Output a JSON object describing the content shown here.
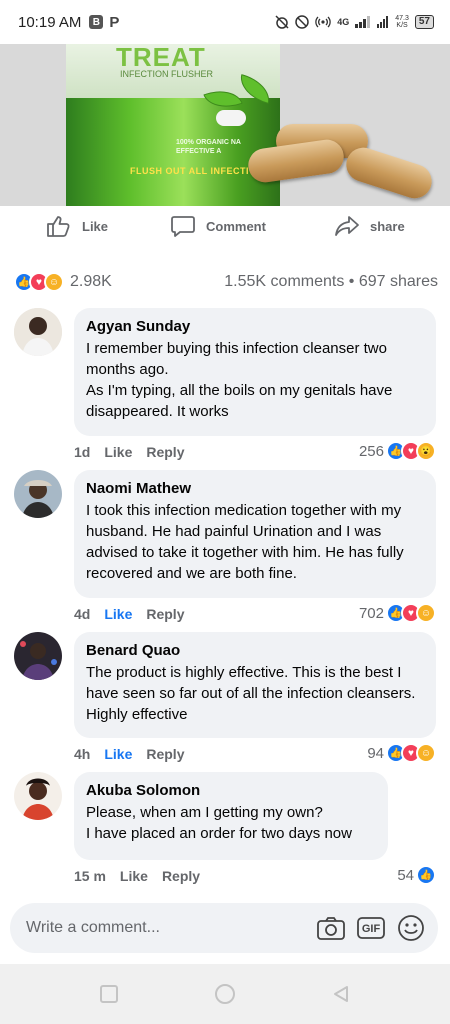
{
  "status_bar": {
    "time": "10:19 AM",
    "app_icon": "B",
    "app_icon2": "P",
    "network": "4G",
    "speed_value": "47.3",
    "speed_unit": "K/S",
    "battery": "57"
  },
  "product": {
    "brand": "TREAT",
    "subtitle": "INFECTION FLUSHER",
    "organic_line1": "100% ORGANIC NA",
    "organic_line2": "EFFECTIVE A",
    "flush_text": "FLUSH OUT ALL INFECTI"
  },
  "actions": {
    "like": "Like",
    "comment": "Comment",
    "share": "share"
  },
  "summary": {
    "reaction_count": "2.98K",
    "comments_shares": "1.55K comments • 697 shares"
  },
  "comments": [
    {
      "name": "Agyan Sunday",
      "text": "I remember buying this infection cleanser two months ago.\nAs I'm typing, all the boils on my genitals have disappeared. It works",
      "time": "1d",
      "like": "Like",
      "reply": "Reply",
      "count": "256",
      "liked": false
    },
    {
      "name": "Naomi Mathew",
      "text": "I took this infection medication together with my husband. He had painful Urination and I was advised to take it together with him. He has fully recovered and we are both fine.",
      "time": "4d",
      "like": "Like",
      "reply": "Reply",
      "count": "702",
      "liked": true
    },
    {
      "name": "Benard Quao",
      "text": "The product is highly effective. This is the best I have seen so far out of all the infection cleansers. Highly effective",
      "time": "4h",
      "like": "Like",
      "reply": "Reply",
      "count": "94",
      "liked": true
    },
    {
      "name": "Akuba Solomon",
      "text": "Please, when am I getting my own?\nI have placed an order for two days now",
      "time": "15 m",
      "like": "Like",
      "reply": "Reply",
      "count": "54",
      "liked": false
    }
  ],
  "composer": {
    "placeholder": "Write a comment...",
    "gif_label": "GIF"
  },
  "colors": {
    "accent": "#1877f2",
    "love": "#f33e58",
    "reaction_yellow": "#f7b125",
    "bubble": "#f0f2f5",
    "text_secondary": "#65676b"
  },
  "icons": {
    "like": "thumbs-up-icon",
    "comment": "speech-bubble-icon",
    "share": "share-arrow-icon",
    "camera": "camera-icon",
    "gif": "gif-icon",
    "emoji": "smiley-icon",
    "nav_recent": "square-icon",
    "nav_home": "circle-icon",
    "nav_back": "triangle-back-icon"
  }
}
